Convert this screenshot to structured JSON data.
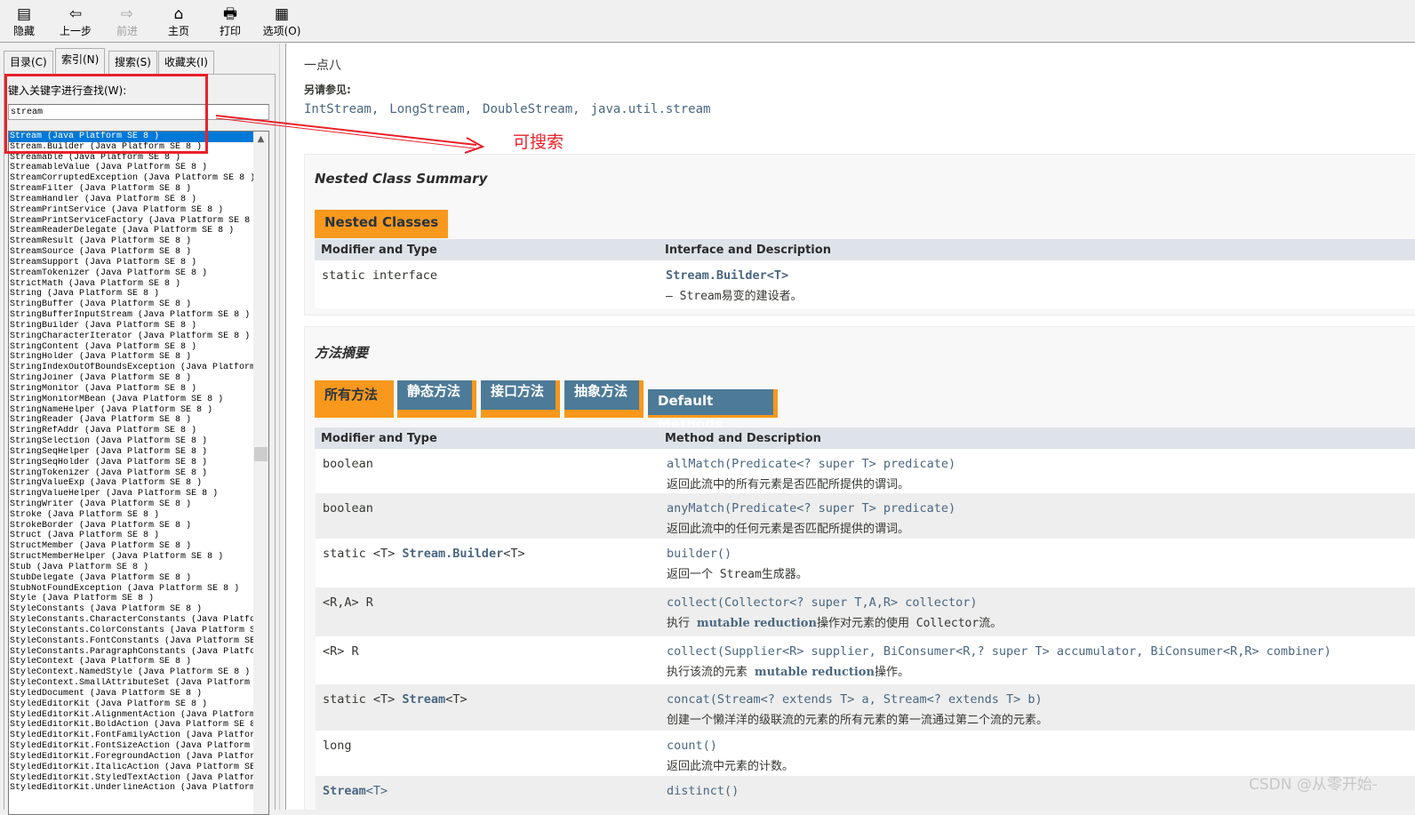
{
  "toolbar": {
    "items": [
      {
        "label": "隐藏",
        "icon": "hide-pane-icon",
        "glyph": "▤"
      },
      {
        "label": "上一步",
        "icon": "back-arrow-icon",
        "glyph": "⇦"
      },
      {
        "label": "前进",
        "icon": "forward-arrow-icon",
        "glyph": "⇨",
        "disabled": true
      },
      {
        "label": "主页",
        "icon": "home-icon",
        "glyph": "⌂"
      },
      {
        "label": "打印",
        "icon": "printer-icon",
        "glyph": "🖶"
      },
      {
        "label": "选项(O)",
        "icon": "options-icon",
        "glyph": "▦"
      }
    ]
  },
  "left": {
    "tabs": [
      "目录(C)",
      "索引(N)",
      "搜索(S)",
      "收藏夹(I)"
    ],
    "active_tab": 1,
    "keyword_label": "键入关键字进行查找(W):",
    "keyword_value": "stream",
    "suffix": "(Java Platform SE 8 )",
    "items": [
      "Stream",
      "Stream.Builder",
      "Streamable",
      "StreamableValue",
      "StreamCorruptedException",
      "StreamFilter",
      "StreamHandler",
      "StreamPrintService",
      "StreamPrintServiceFactory",
      "StreamReaderDelegate",
      "StreamResult",
      "StreamSource",
      "StreamSupport",
      "StreamTokenizer",
      "StrictMath",
      "String",
      "StringBuffer",
      "StringBufferInputStream",
      "StringBuilder",
      "StringCharacterIterator",
      "StringContent",
      "StringHolder",
      "StringIndexOutOfBoundsException",
      "StringJoiner",
      "StringMonitor",
      "StringMonitorMBean",
      "StringNameHelper",
      "StringReader",
      "StringRefAddr",
      "StringSelection",
      "StringSeqHelper",
      "StringSeqHolder",
      "StringTokenizer",
      "StringValueExp",
      "StringValueHelper",
      "StringWriter",
      "Stroke",
      "StrokeBorder",
      "Struct",
      "StructMember",
      "StructMemberHelper",
      "Stub",
      "StubDelegate",
      "StubNotFoundException",
      "Style",
      "StyleConstants",
      "StyleConstants.CharacterConstants",
      "StyleConstants.ColorConstants",
      "StyleConstants.FontConstants",
      "StyleConstants.ParagraphConstants",
      "StyleContext",
      "StyleContext.NamedStyle",
      "StyleContext.SmallAttributeSet",
      "StyledDocument",
      "StyledEditorKit",
      "StyledEditorKit.AlignmentAction",
      "StyledEditorKit.BoldAction",
      "StyledEditorKit.FontFamilyAction",
      "StyledEditorKit.FontSizeAction",
      "StyledEditorKit.ForegroundAction",
      "StyledEditorKit.ItalicAction",
      "StyledEditorKit.StyledTextAction",
      "StyledEditorKit.UnderlineAction"
    ],
    "selected_index": 0
  },
  "content": {
    "since": "一点八",
    "see_also_label": "另请参见:",
    "see_also": [
      "IntStream,",
      "LongStream,",
      "DoubleStream,",
      "java.util.stream"
    ],
    "nested": {
      "title": "Nested Class Summary",
      "tab": "Nested Classes",
      "headers": [
        "Modifier and Type",
        "Interface and Description"
      ],
      "rows": [
        {
          "type": "static interface",
          "name": "Stream.Builder<T>",
          "desc": "— Stream易变的建设者。"
        }
      ]
    },
    "methods": {
      "title": "方法摘要",
      "tabs": [
        "所有方法",
        "静态方法",
        "接口方法",
        "抽象方法",
        "Default Methods"
      ],
      "headers": [
        "Modifier and Type",
        "Method and Description"
      ],
      "rows": [
        {
          "type": "boolean",
          "sig": "allMatch(Predicate<? super T> predicate)",
          "desc": "返回此流中的所有元素是否匹配所提供的谓词。"
        },
        {
          "type": "boolean",
          "sig": "anyMatch(Predicate<? super T> predicate)",
          "desc": "返回此流中的任何元素是否匹配所提供的谓词。"
        },
        {
          "type": "static <T> Stream.Builder<T>",
          "sig": "builder()",
          "desc": "返回一个 Stream生成器。"
        },
        {
          "type": "<R,A> R",
          "sig": "collect(Collector<? super T,A,R> collector)",
          "desc": "执行 mutable reduction操作对元素的使用 Collector流。"
        },
        {
          "type": "<R> R",
          "sig": "collect(Supplier<R> supplier, BiConsumer<R,? super T> accumulator, BiConsumer<R,R> combiner)",
          "desc": "执行该流的元素 mutable reduction操作。"
        },
        {
          "type": "static <T> Stream<T>",
          "sig": "concat(Stream<? extends T> a, Stream<? extends T> b)",
          "desc": "创建一个懒洋洋的级联流的元素的所有元素的第一流通过第二个流的元素。"
        },
        {
          "type": "long",
          "sig": "count()",
          "desc": "返回此流中元素的计数。"
        },
        {
          "type": "Stream<T>",
          "sig": "distinct()",
          "desc": ""
        }
      ]
    }
  },
  "annotation": {
    "text": "可搜索",
    "color": "#e8212a"
  },
  "watermark": "CSDN @从零开始-",
  "colors": {
    "orange_tab": "#f8981d",
    "blue_tab": "#4d7a97",
    "link": "#4a6782",
    "header_row": "#dee3e9",
    "alt_row": "#eeeeee",
    "selection": "#0078d7"
  }
}
